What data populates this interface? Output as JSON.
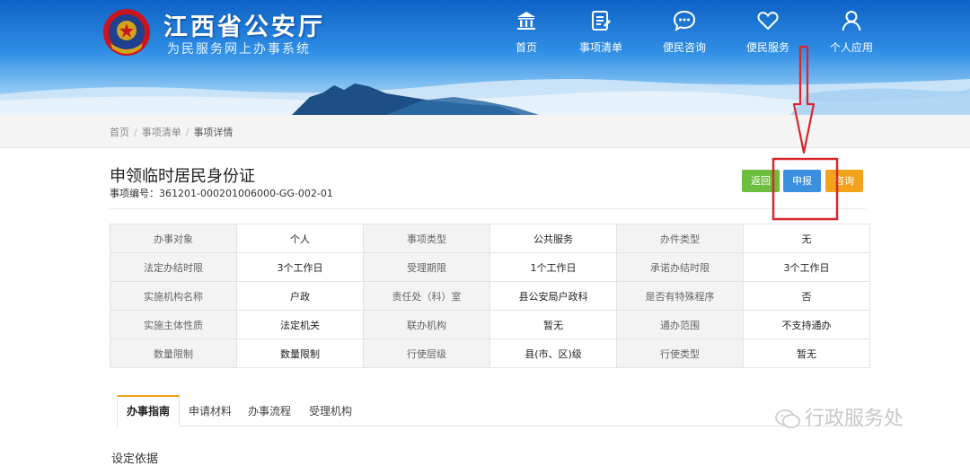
{
  "header": {
    "title": "江西省公安厅",
    "subtitle": "为民服务网上办事系统",
    "nav": [
      {
        "label": "首页",
        "icon": "bank-icon"
      },
      {
        "label": "事项清单",
        "icon": "checklist-icon"
      },
      {
        "label": "便民咨询",
        "icon": "chat-bubble-icon"
      },
      {
        "label": "便民服务",
        "icon": "heart-icon"
      },
      {
        "label": "个人应用",
        "icon": "user-icon"
      }
    ]
  },
  "breadcrumb": [
    "首页",
    "事项清单",
    "事项详情"
  ],
  "item": {
    "title": "申领临时居民身份证",
    "code_label": "事项编号：",
    "code": "361201-000201006000-GG-002-01"
  },
  "actions": {
    "back": "返回",
    "apply": "申报",
    "consult": "咨询"
  },
  "info_rows": [
    [
      [
        "办事对象",
        "个人"
      ],
      [
        "事项类型",
        "公共服务"
      ],
      [
        "办件类型",
        "无"
      ]
    ],
    [
      [
        "法定办结时限",
        "3个工作日"
      ],
      [
        "受理期限",
        "1个工作日"
      ],
      [
        "承诺办结时限",
        "3个工作日"
      ]
    ],
    [
      [
        "实施机构名称",
        "户政"
      ],
      [
        "责任处（科）室",
        "县公安局户政科"
      ],
      [
        "是否有特殊程序",
        "否"
      ]
    ],
    [
      [
        "实施主体性质",
        "法定机关"
      ],
      [
        "联办机构",
        "暂无"
      ],
      [
        "通办范围",
        "不支持通办"
      ]
    ],
    [
      [
        "数量限制",
        "数量限制"
      ],
      [
        "行使层级",
        "县(市、区)级"
      ],
      [
        "行使类型",
        "暂无"
      ]
    ]
  ],
  "tabs": [
    "办事指南",
    "申请材料",
    "办事流程",
    "受理机构"
  ],
  "section_heading": "设定依据",
  "watermark": "行政服务处",
  "colors": {
    "back": "#6cbf3c",
    "apply": "#3a8fde",
    "consult": "#f3a21b",
    "annotation": "#d9262b"
  }
}
